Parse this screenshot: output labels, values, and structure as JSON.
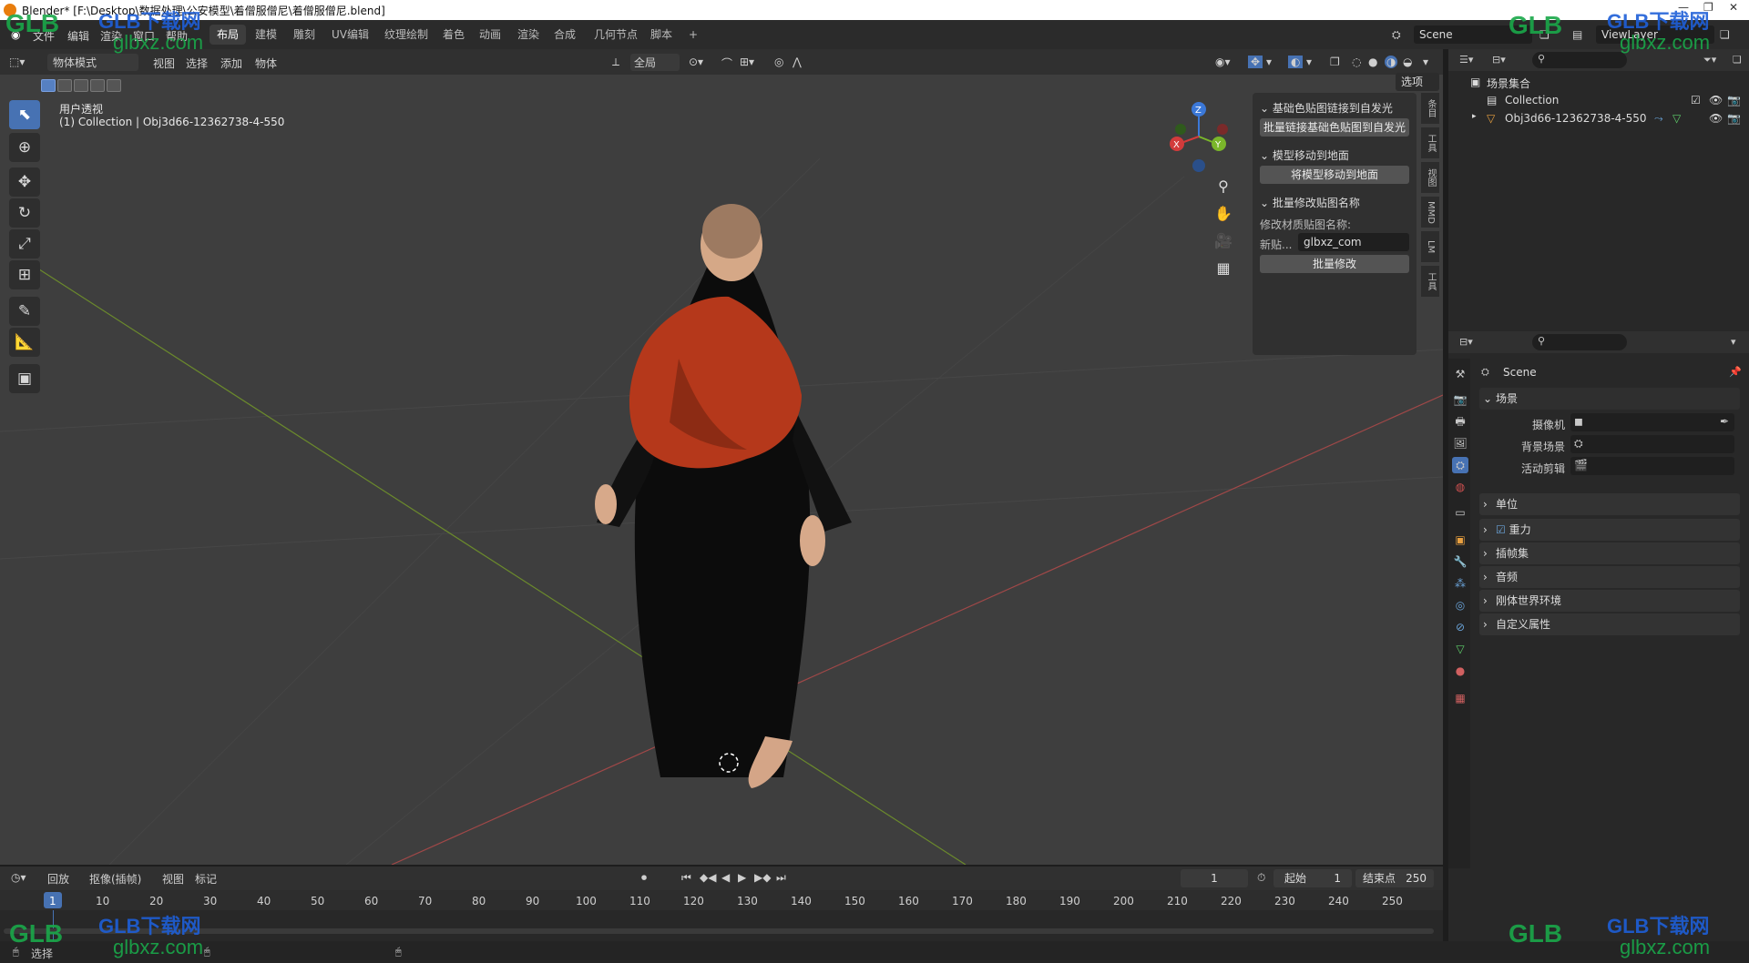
{
  "window": {
    "title": "Blender* [F:\\Desktop\\数据处理\\公安模型\\着僧服僧尼\\着僧服僧尼.blend]"
  },
  "menu": {
    "items": [
      "文件",
      "编辑",
      "渲染",
      "窗口",
      "帮助"
    ]
  },
  "workspaces": {
    "tabs": [
      "布局",
      "建模",
      "雕刻",
      "UV编辑",
      "纹理绘制",
      "着色",
      "动画",
      "渲染",
      "合成",
      "几何节点",
      "脚本"
    ],
    "add": "+"
  },
  "scene": {
    "name": "Scene",
    "view_layer": "ViewLayer"
  },
  "viewport_header": {
    "mode": "物体模式",
    "items": [
      "视图",
      "选择",
      "添加",
      "物体"
    ],
    "transform_orientation": "全局",
    "options": "选项"
  },
  "viewport": {
    "view_name": "用户透视",
    "collection_line": "(1) Collection | Obj3d66-12362738-4-550"
  },
  "gizmo": {
    "x": "X",
    "y": "Y",
    "z": "Z"
  },
  "npanel": {
    "sections": [
      {
        "title": "基础色贴图链接到自发光",
        "button": "批量链接基础色贴图到自发光"
      },
      {
        "title": "模型移动到地面",
        "button": "将模型移动到地面"
      },
      {
        "title": "批量修改贴图名称",
        "label": "修改材质贴图名称:",
        "field_label": "新贴...",
        "field_value": "glbxz_com",
        "button": "批量修改"
      }
    ],
    "tabs": [
      "条目",
      "工具",
      "视图",
      "MMD",
      "LM",
      "工具"
    ]
  },
  "outliner": {
    "root": "场景集合",
    "collection": "Collection",
    "object": "Obj3d66-12362738-4-550"
  },
  "properties": {
    "scene_name": "Scene",
    "section_scene": "场景",
    "rows": [
      {
        "label": "摄像机"
      },
      {
        "label": "背景场景"
      },
      {
        "label": "活动剪辑"
      }
    ],
    "collapsed": [
      "单位",
      "重力",
      "插帧集",
      "音频",
      "刚体世界环境",
      "自定义属性"
    ]
  },
  "timeline": {
    "menus": [
      "回放",
      "抠像(插帧)",
      "视图",
      "标记"
    ],
    "current_frame": "1",
    "start_label": "起始",
    "start": "1",
    "end_label": "结束点",
    "end": "250",
    "frame_numbers": [
      "1",
      "10",
      "20",
      "30",
      "40",
      "50",
      "60",
      "70",
      "80",
      "90",
      "100",
      "110",
      "120",
      "130",
      "140",
      "150",
      "160",
      "170",
      "180",
      "190",
      "200",
      "210",
      "220",
      "230",
      "240",
      "250"
    ]
  },
  "status": {
    "text": "选择"
  },
  "watermark": {
    "brand": "GLB下载网",
    "site": "glbxz.com",
    "logo": "GLB"
  }
}
